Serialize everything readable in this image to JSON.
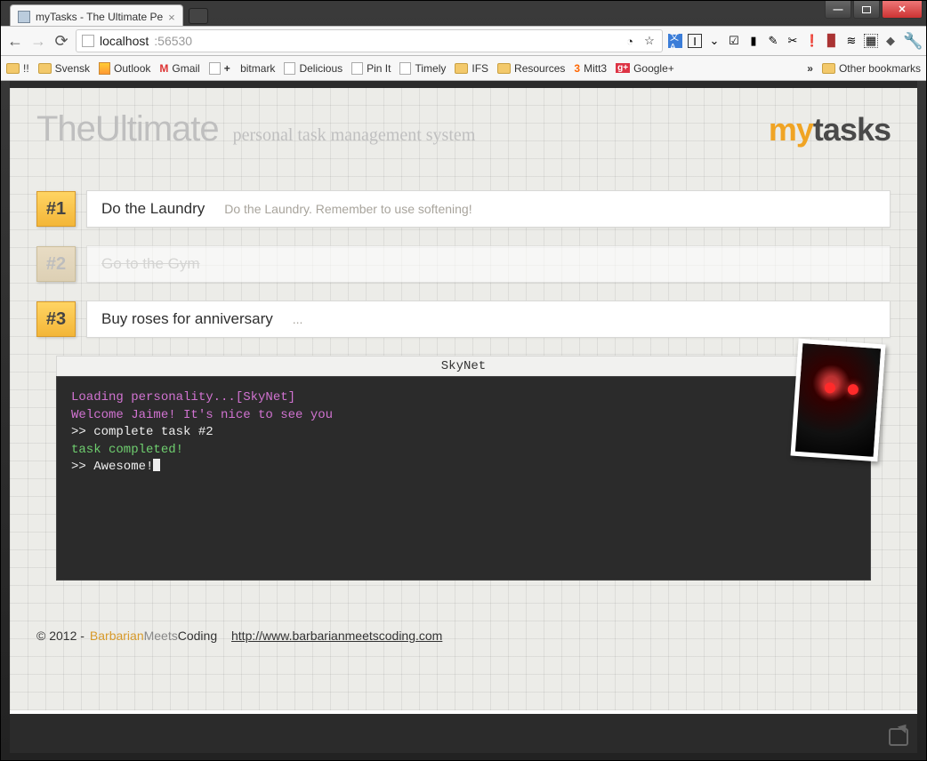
{
  "browser": {
    "tab_title": "myTasks - The Ultimate Pe",
    "url_host": "localhost",
    "url_port": ":56530",
    "bookmarks": [
      {
        "label": "!!",
        "type": "folder"
      },
      {
        "label": "Svensk",
        "type": "folder"
      },
      {
        "label": "Outlook",
        "type": "page"
      },
      {
        "label": "Gmail",
        "type": "gmail"
      },
      {
        "label": "bitmark",
        "type": "page-plus"
      },
      {
        "label": "Delicious",
        "type": "page"
      },
      {
        "label": "Pin It",
        "type": "page"
      },
      {
        "label": "Timely",
        "type": "page"
      },
      {
        "label": "IFS",
        "type": "folder"
      },
      {
        "label": "Resources",
        "type": "folder"
      },
      {
        "label": "Mitt3",
        "type": "mitt3"
      },
      {
        "label": "Google+",
        "type": "gplus"
      }
    ],
    "other_bookmarks": "Other bookmarks"
  },
  "header": {
    "title_left": "TheUltimate",
    "subtitle": "personal task management system",
    "logo_my": "my",
    "logo_tasks": "tasks"
  },
  "tasks": [
    {
      "num": "#1",
      "title": "Do the Laundry",
      "desc": "Do the Laundry. Remember to use softening!",
      "completed": false
    },
    {
      "num": "#2",
      "title": "Go to the Gym",
      "desc": "",
      "completed": true
    },
    {
      "num": "#3",
      "title": "Buy roses for anniversary",
      "desc": "...",
      "completed": false
    }
  ],
  "terminal": {
    "title": "SkyNet",
    "lines": [
      {
        "cls": "mag",
        "text": "Loading personality...[SkyNet]"
      },
      {
        "cls": "mag",
        "text": "Welcome Jaime! It's nice to see you"
      },
      {
        "cls": "wht",
        "text": ">> complete task #2"
      },
      {
        "cls": "grn",
        "text": "task completed!"
      },
      {
        "cls": "wht",
        "text": ">> Awesome!",
        "cursor": true
      }
    ]
  },
  "footer": {
    "copyright": "© 2012 - ",
    "brand1": "Barbarian",
    "brand2": "Meets",
    "brand3": "Coding",
    "url": "http://www.barbarianmeetscoding.com"
  }
}
